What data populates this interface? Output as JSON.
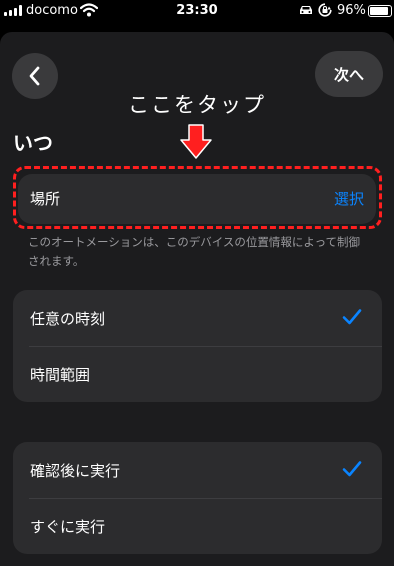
{
  "status_bar": {
    "carrier": "docomo",
    "time": "23:30",
    "battery": "96%",
    "battery_level": 0.96,
    "icons": [
      "signal-icon",
      "wifi-icon",
      "car-icon",
      "lock-rotation-icon",
      "battery-icon"
    ]
  },
  "nav": {
    "back_icon": "chevron-left-icon",
    "next_label": "次へ"
  },
  "annotation": {
    "text": "ここをタップ",
    "arrow_icon": "down-arrow-icon",
    "color": "#ff1f1f"
  },
  "when": {
    "title": "いつ",
    "location_label": "場所",
    "location_action": "選択",
    "footnote": "このオートメーションは、このデバイスの位置情報によって制御されます。"
  },
  "timing_options": [
    {
      "label": "任意の時刻",
      "selected": true
    },
    {
      "label": "時間範囲",
      "selected": false
    }
  ],
  "run_options": [
    {
      "label": "確認後に実行",
      "selected": true
    },
    {
      "label": "すぐに実行",
      "selected": false
    }
  ],
  "colors": {
    "accent": "#0a84ff",
    "background": "#1c1c1e",
    "cell": "#2c2c2e"
  }
}
